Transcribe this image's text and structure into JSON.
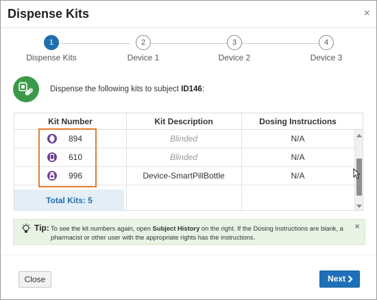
{
  "dialog": {
    "title": "Dispense Kits",
    "close_symbol": "×"
  },
  "stepper": {
    "steps": [
      {
        "number": "1",
        "label": "Dispense Kits",
        "active": true
      },
      {
        "number": "2",
        "label": "Device 1",
        "active": false
      },
      {
        "number": "3",
        "label": "Device 2",
        "active": false
      },
      {
        "number": "4",
        "label": "Device 3",
        "active": false
      }
    ]
  },
  "intro": {
    "icon": "kit-dispense-icon",
    "text": "Dispense the following kits to subject ",
    "subject_id": "ID146",
    "suffix": ":"
  },
  "table": {
    "headers": [
      "Kit Number",
      "Kit Description",
      "Dosing Instructions"
    ],
    "rows": [
      {
        "icon": "watch-device-icon",
        "kit_number": "894",
        "description": "Blinded",
        "blinded": true,
        "dosing": "N/A"
      },
      {
        "icon": "phone-device-icon",
        "kit_number": "610",
        "description": "Blinded",
        "blinded": true,
        "dosing": "N/A"
      },
      {
        "icon": "pill-bottle-icon",
        "kit_number": "996",
        "description": "Device-SmartPillBottle",
        "blinded": false,
        "dosing": "N/A"
      }
    ],
    "total_label": "Total Kits: 5"
  },
  "tip": {
    "label": "Tip:",
    "text_before": "To see the kit numbers again, open ",
    "link_text": "Subject History",
    "text_after": " on the right. If the Dosing Instructions are blank, a pharmacist or other user with the appropriate rights has the instructions.",
    "close_symbol": "×"
  },
  "footer": {
    "close_label": "Close",
    "next_label": "Next"
  },
  "colors": {
    "primary": "#1d70b8",
    "step_active": "#1f6fb0",
    "kit_icon": "#6d3f97",
    "intro_icon": "#3a9a4a",
    "highlight": "#e87a2a",
    "tip_bg": "#e8f3e4"
  }
}
